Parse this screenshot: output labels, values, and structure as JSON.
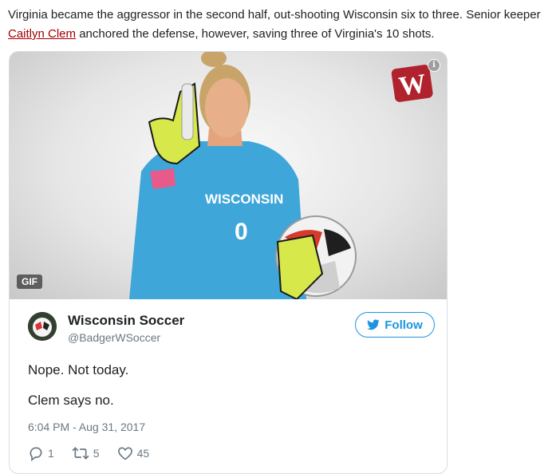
{
  "article": {
    "line1": "Virginia became the aggressor in the second half, out-shooting Wisconsin six to three. Senior keeper",
    "link_text": "Caitlyn Clem",
    "line2": " anchored the defense, however, saving three of Virginia's 10 shots."
  },
  "media": {
    "gif_badge": "GIF",
    "info_glyph": "i",
    "jersey_text": "WISCONSIN",
    "jersey_number": "0",
    "logo_letter": "W",
    "colors": {
      "jersey": "#3ea6d8",
      "gloves": "#d7e84a",
      "logo": "#b0222d"
    }
  },
  "tweet": {
    "display_name": "Wisconsin Soccer",
    "handle": "@BadgerWSoccer",
    "follow_label": "Follow",
    "text_lines": [
      "Nope. Not today.",
      "Clem says no."
    ],
    "timestamp": "6:04 PM - Aug 31, 2017",
    "reply_count": "1",
    "retweet_count": "5",
    "like_count": "45",
    "accent": "#1b95e0"
  }
}
